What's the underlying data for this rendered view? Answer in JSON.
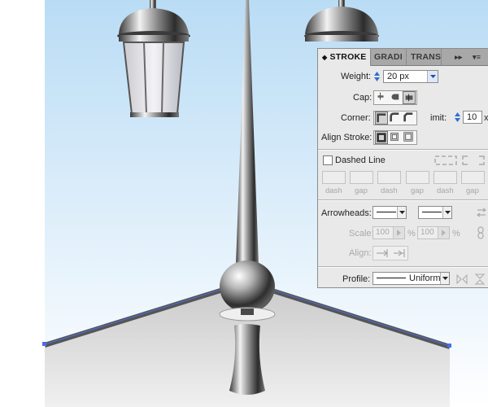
{
  "panel": {
    "tabs": [
      {
        "label": "STROKE",
        "active": true
      },
      {
        "label": "GRADI",
        "active": false
      },
      {
        "label": "TRANS",
        "active": false
      }
    ],
    "weight": {
      "label": "Weight:",
      "value": "20 px"
    },
    "cap": {
      "label": "Cap:",
      "selected": "projecting-cap"
    },
    "corner": {
      "label": "Corner:",
      "limit_label": "imit:",
      "limit_value": "10",
      "limit_unit": "x"
    },
    "align": {
      "label": "Align Stroke:"
    },
    "dashed": {
      "label": "Dashed Line",
      "checked": false,
      "field_labels": [
        "dash",
        "gap",
        "dash",
        "gap",
        "dash",
        "gap"
      ]
    },
    "arrowheads": {
      "label": "Arrowheads:"
    },
    "scale": {
      "label": "Scale:",
      "start": "100",
      "end": "100",
      "unit": "%"
    },
    "align_arrows": {
      "label": "Align:"
    },
    "profile": {
      "label": "Profile:",
      "value": "Uniform"
    }
  },
  "colors": {
    "sky_top": "#b9dcf5",
    "annotation_arrow": "#e8141c",
    "selection_path": "#4a6fe3"
  }
}
